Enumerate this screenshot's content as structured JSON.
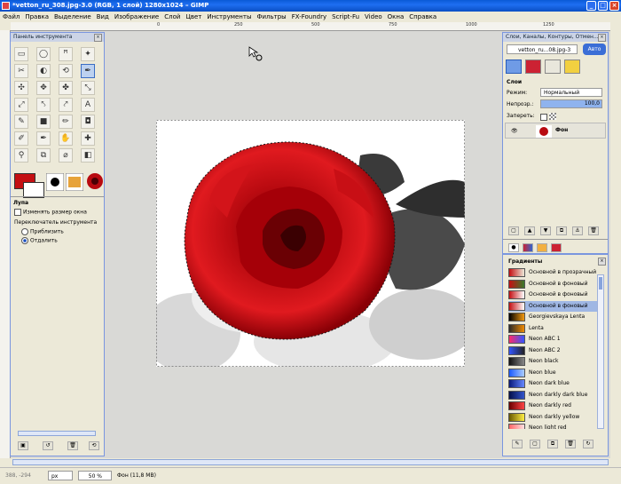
{
  "window": {
    "title": "*vetton_ru_308.jpg-3.0 (RGB, 1 слой) 1280x1024 – GIMP",
    "controls": {
      "min": "_",
      "max": "□",
      "close": "×"
    }
  },
  "menu": [
    "Файл",
    "Правка",
    "Выделение",
    "Вид",
    "Изображение",
    "Слой",
    "Цвет",
    "Инструменты",
    "Фильтры",
    "FX-Foundry",
    "Script-Fu",
    "Video",
    "Окна",
    "Справка"
  ],
  "ruler_labels": [
    "0",
    "250",
    "500",
    "750",
    "1000",
    "1250"
  ],
  "toolbox": {
    "title": "Панель инструмента",
    "tools": [
      "▭",
      "◯",
      "ꟸ",
      "✦",
      "✂",
      "◐",
      "⟲",
      "✒",
      "✣",
      "✥",
      "✤",
      "⤡",
      "⤢",
      "⤣",
      "⤤",
      "A",
      "✎",
      "■",
      "✏",
      "◘",
      "✐",
      "✒",
      "✋",
      "✚",
      "⚲",
      "⧉",
      "⌀",
      "◧"
    ],
    "options_title": "Лупа",
    "resize_label": "Изменять размер окна",
    "switch_label": "Переключатель инструмента",
    "zoom_in": "Приблизить",
    "zoom_out": "Отдалить",
    "colors": {
      "fg": "#c40f12",
      "bg": "#ffffff",
      "accent": "#1a4fc0"
    }
  },
  "layers_dock": {
    "title": "Слои, Каналы, Контуры, Отмен...",
    "image_select": "vetton_ru...08.jpg-3",
    "auto_button": "Авто",
    "panel_title": "Слои",
    "mode_label": "Режим:",
    "mode_value": "Нормальный",
    "opacity_label": "Непрозр.:",
    "opacity_value": "100,0",
    "opacity_fraction": 1.0,
    "lock_label": "Запереть:",
    "layer_name": "Фон"
  },
  "gradients_dock": {
    "title": "Градиенты",
    "items": [
      {
        "name": "Основной в прозрачный",
        "c1": "#c40f12",
        "c2": "rgba(255,255,255,0)"
      },
      {
        "name": "Основной в фоновый",
        "c1": "#c40f12",
        "c2": "#3a7a2a"
      },
      {
        "name": "Основной в фоновый",
        "c1": "#c40f12",
        "c2": "#ffffff"
      },
      {
        "name": "Основной в фоновый",
        "c1": "#c40f12",
        "c2": "#ffffff"
      },
      {
        "name": "Georgievskaya Lenta",
        "c1": "#000000",
        "c2": "#f49a10"
      },
      {
        "name": "Lenta",
        "c1": "#2a2a2a",
        "c2": "#f08a00"
      },
      {
        "name": "Neon ABC 1",
        "c1": "#ff2a6a",
        "c2": "#3355ff"
      },
      {
        "name": "Neon ABC 2",
        "c1": "#3355ff",
        "c2": "#222222"
      },
      {
        "name": "Neon black",
        "c1": "#111111",
        "c2": "#888888"
      },
      {
        "name": "Neon blue",
        "c1": "#1a5aff",
        "c2": "#aaccff"
      },
      {
        "name": "Neon dark blue",
        "c1": "#0a1a7a",
        "c2": "#6688ff"
      },
      {
        "name": "Neon darkly dark blue",
        "c1": "#05104a",
        "c2": "#3355cc"
      },
      {
        "name": "Neon darkly red",
        "c1": "#6a0000",
        "c2": "#ff4444"
      },
      {
        "name": "Neon darkly yellow",
        "c1": "#6a5a00",
        "c2": "#ffee44"
      },
      {
        "name": "Neon light red",
        "c1": "#ff6666",
        "c2": "#ffe0e0"
      }
    ],
    "selected_index": 3
  },
  "status": {
    "coords": "388, -294",
    "unit": "px",
    "zoom": "50 %",
    "info": "Фон (11,8 MB)"
  }
}
